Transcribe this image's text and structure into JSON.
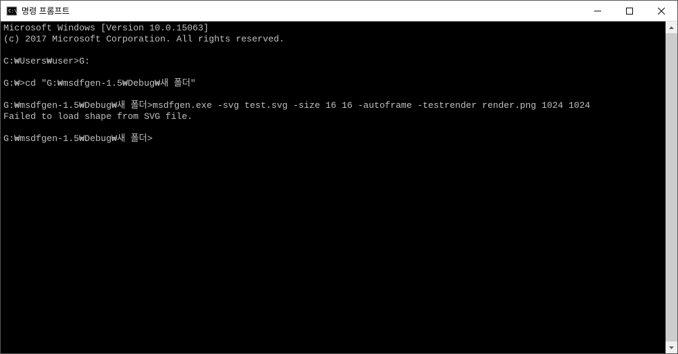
{
  "window": {
    "title": "명령 프롬프트"
  },
  "terminal": {
    "lines": [
      "Microsoft Windows [Version 10.0.15063]",
      "(c) 2017 Microsoft Corporation. All rights reserved.",
      "",
      "C:\\Users\\user>G:",
      "",
      "G:\\>cd \"G:\\msdfgen-1.5\\Debug\\새 폴더\"",
      "",
      "G:\\msdfgen-1.5\\Debug\\새 폴더>msdfgen.exe -svg test.svg -size 16 16 -autoframe -testrender render.png 1024 1024",
      "Failed to load shape from SVG file.",
      "",
      "G:\\msdfgen-1.5\\Debug\\새 폴더>"
    ]
  }
}
